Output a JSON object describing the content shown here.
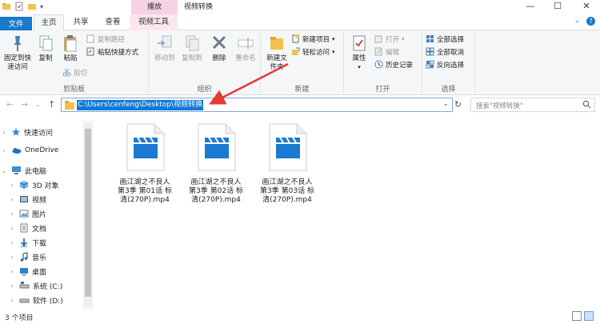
{
  "title_bar": {
    "context_tab": "播放",
    "window_title": "视频转换",
    "minimize": "—",
    "maximize": "☐",
    "close": "✕"
  },
  "tabs": {
    "file": "文件",
    "home": "主页",
    "share": "共享",
    "view": "查看",
    "video_tools": "视频工具"
  },
  "ribbon": {
    "clipboard": {
      "label": "剪贴板",
      "pin": "固定到快速访问",
      "copy": "复制",
      "paste": "粘贴",
      "copy_path": "复制路径",
      "paste_shortcut": "粘贴快捷方式",
      "cut": "剪切"
    },
    "organize": {
      "label": "组织",
      "move_to": "移动到",
      "copy_to": "复制到",
      "delete": "删除",
      "rename": "重命名"
    },
    "new": {
      "label": "新建",
      "new_folder": "新建文件夹",
      "new_item": "新建项目",
      "easy_access": "轻松访问"
    },
    "open": {
      "label": "打开",
      "properties": "属性",
      "open": "打开",
      "edit": "编辑",
      "history": "历史记录"
    },
    "select": {
      "label": "选择",
      "select_all": "全部选择",
      "select_none": "全部取消",
      "invert": "反向选择"
    }
  },
  "address": {
    "path": "C:\\Users\\cenfeng\\Desktop\\视频转换",
    "search_placeholder": "搜索\"视频转换\""
  },
  "nav_pane": {
    "items": [
      {
        "label": "快速访问",
        "icon": "star-icon"
      },
      {
        "label": "OneDrive",
        "icon": "cloud-icon"
      },
      {
        "label": "此电脑",
        "icon": "pc-icon"
      },
      {
        "label": "3D 对象",
        "icon": "cube-icon"
      },
      {
        "label": "视频",
        "icon": "video-folder-icon"
      },
      {
        "label": "图片",
        "icon": "pictures-icon"
      },
      {
        "label": "文档",
        "icon": "documents-icon"
      },
      {
        "label": "下载",
        "icon": "download-icon"
      },
      {
        "label": "音乐",
        "icon": "music-icon"
      },
      {
        "label": "桌面",
        "icon": "desktop-icon"
      },
      {
        "label": "系统 (C:)",
        "icon": "drive-icon"
      },
      {
        "label": "软件 (D:)",
        "icon": "drive-icon"
      }
    ]
  },
  "files": [
    {
      "line1": "画江湖之不良人",
      "line2": "第3季 第01话 标",
      "line3": "清(270P).mp4"
    },
    {
      "line1": "画江湖之不良人",
      "line2": "第3季 第02话 标",
      "line3": "清(270P).mp4"
    },
    {
      "line1": "画江湖之不良人",
      "line2": "第3季 第03话 标",
      "line3": "清(270P).mp4"
    }
  ],
  "status": {
    "count": "3 个项目"
  },
  "colors": {
    "accent": "#1979ca",
    "selection": "#0f78d7",
    "annotation": "#e53935"
  }
}
